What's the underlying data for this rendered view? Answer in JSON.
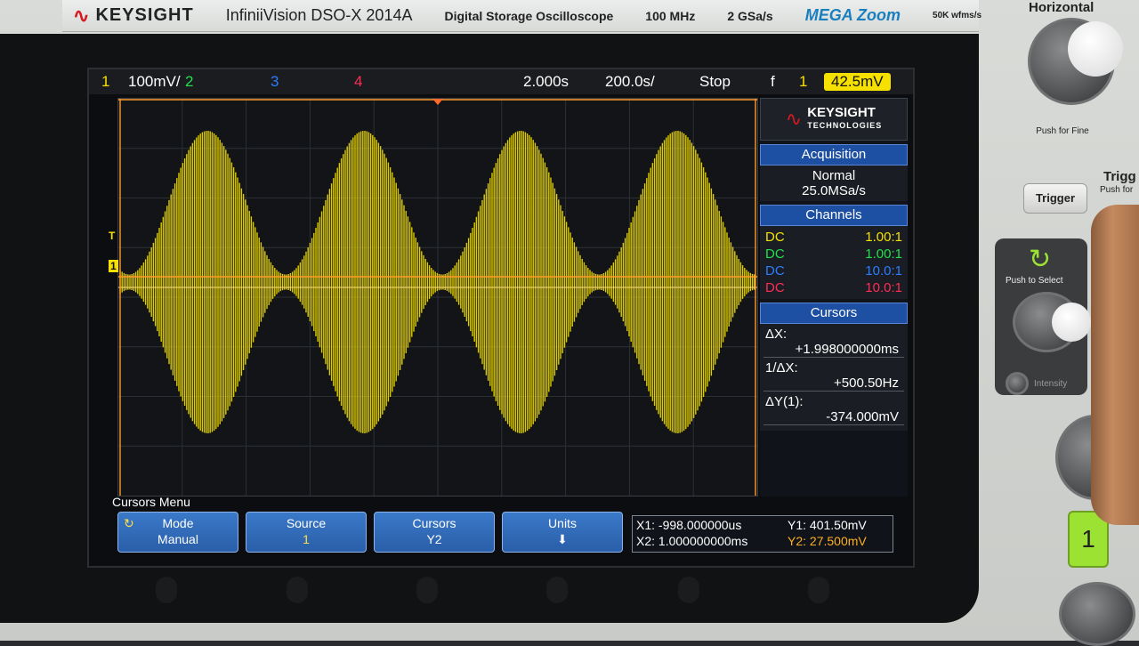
{
  "header": {
    "brand": "KEYSIGHT",
    "model": "InfiniiVision DSO-X 2014A",
    "type": "Digital Storage Oscilloscope",
    "bandwidth": "100 MHz",
    "sample_rate": "2 GSa/s",
    "megazoom": "MEGA Zoom",
    "wfms": "50K wfms/s"
  },
  "status": {
    "ch1_num": "1",
    "ch1_scale": "100mV/",
    "ch2_num": "2",
    "ch3_num": "3",
    "ch4_num": "4",
    "time_pos": "2.000s",
    "time_scale": "200.0s/",
    "run_state": "Stop",
    "trig_slope": "f",
    "trig_source": "1",
    "trig_level": "42.5mV"
  },
  "colors": {
    "ch1": "#f5e000",
    "ch2": "#22e04a",
    "ch3": "#2c7cff",
    "ch4": "#ff2d55",
    "softkey": "#2a5ea8"
  },
  "panel": {
    "logo": "KEYSIGHT",
    "logo_sub": "TECHNOLOGIES",
    "acq_title": "Acquisition",
    "acq_mode": "Normal",
    "acq_rate": "25.0MSa/s",
    "channels_title": "Channels",
    "channels": [
      {
        "coupling": "DC",
        "probe": "1.00:1"
      },
      {
        "coupling": "DC",
        "probe": "1.00:1"
      },
      {
        "coupling": "DC",
        "probe": "10.0:1"
      },
      {
        "coupling": "DC",
        "probe": "10.0:1"
      }
    ],
    "cursors_title": "Cursors",
    "dx_label": "ΔX:",
    "dx_value": "+1.998000000ms",
    "inv_dx_label": "1/ΔX:",
    "inv_dx_value": "+500.50Hz",
    "dy_label": "ΔY(1):",
    "dy_value": "-374.000mV"
  },
  "menu": {
    "title": "Cursors Menu",
    "mode_label": "Mode",
    "mode_value": "Manual",
    "source_label": "Source",
    "source_value": "1",
    "cursors_label": "Cursors",
    "cursors_value": "Y2",
    "units_label": "Units",
    "units_icon": "down-arrow-icon",
    "x1": "X1: -998.000000us",
    "x2": "X2: 1.000000000ms",
    "y1": "Y1: 401.50mV",
    "y2": "Y2: 27.500mV"
  },
  "controls": {
    "horizontal": "Horizontal",
    "push_fine": "Push for Fine",
    "trigger_section": "Trigg",
    "push_for": "Push for",
    "trigger_btn": "Trigger",
    "push_select": "Push to Select",
    "intensity": "Intensity",
    "channel_btn": "1"
  },
  "markers": {
    "trig_mark": "T",
    "ch_mark": "1"
  }
}
